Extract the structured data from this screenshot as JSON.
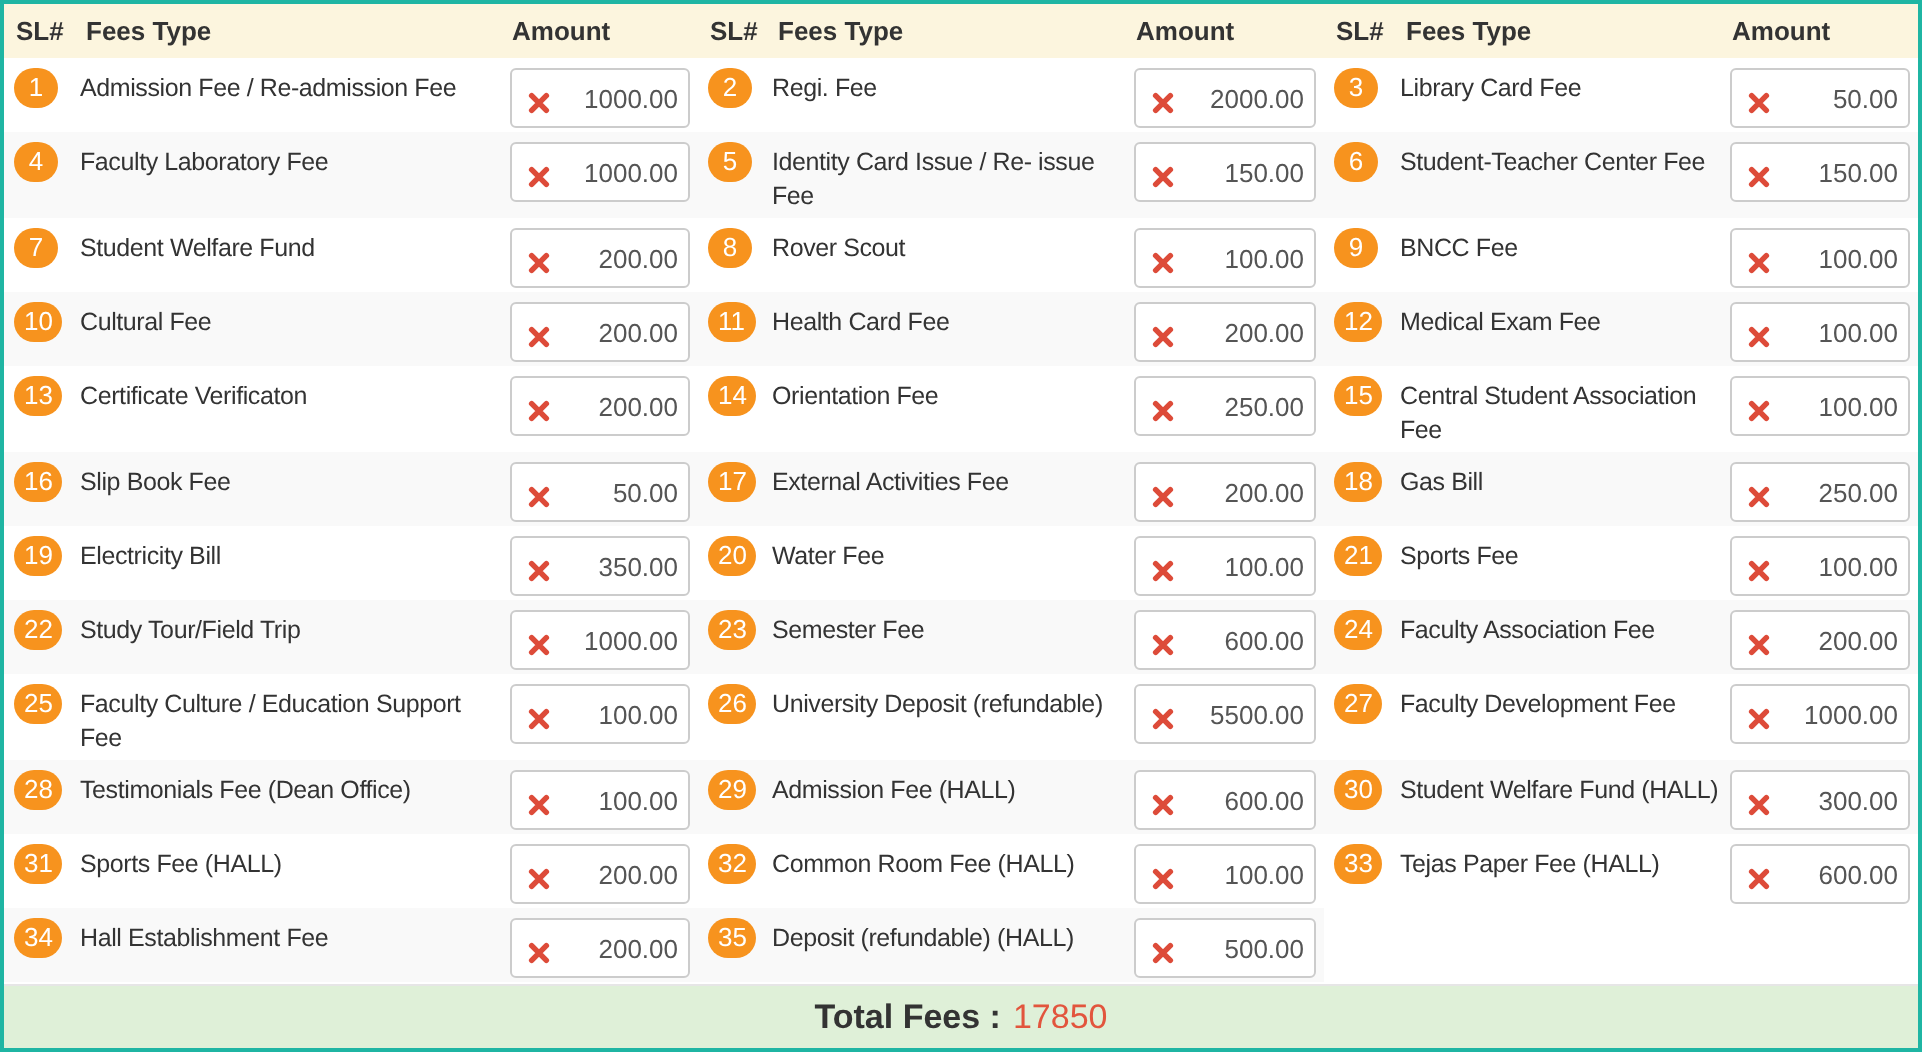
{
  "columns": [
    {
      "sl": "SL#",
      "type": "Fees Type",
      "amount": "Amount"
    },
    {
      "sl": "SL#",
      "type": "Fees Type",
      "amount": "Amount"
    },
    {
      "sl": "SL#",
      "type": "Fees Type",
      "amount": "Amount"
    }
  ],
  "fees": [
    {
      "no": "1",
      "name": "Admission Fee / Re-admission Fee",
      "amount": "1000.00"
    },
    {
      "no": "2",
      "name": "Regi. Fee",
      "amount": "2000.00"
    },
    {
      "no": "3",
      "name": "Library Card Fee",
      "amount": "50.00"
    },
    {
      "no": "4",
      "name": "Faculty Laboratory Fee",
      "amount": "1000.00"
    },
    {
      "no": "5",
      "name": "Identity Card Issue / Re- issue Fee",
      "amount": "150.00"
    },
    {
      "no": "6",
      "name": "Student-Teacher Center Fee",
      "amount": "150.00"
    },
    {
      "no": "7",
      "name": "Student Welfare Fund",
      "amount": "200.00"
    },
    {
      "no": "8",
      "name": "Rover Scout",
      "amount": "100.00"
    },
    {
      "no": "9",
      "name": "BNCC Fee",
      "amount": "100.00"
    },
    {
      "no": "10",
      "name": "Cultural Fee",
      "amount": "200.00"
    },
    {
      "no": "11",
      "name": "Health Card Fee",
      "amount": "200.00"
    },
    {
      "no": "12",
      "name": "Medical Exam Fee",
      "amount": "100.00"
    },
    {
      "no": "13",
      "name": "Certificate Verificaton",
      "amount": "200.00"
    },
    {
      "no": "14",
      "name": "Orientation Fee",
      "amount": "250.00"
    },
    {
      "no": "15",
      "name": "Central Student Association Fee",
      "amount": "100.00"
    },
    {
      "no": "16",
      "name": "Slip Book Fee",
      "amount": "50.00"
    },
    {
      "no": "17",
      "name": "External Activities Fee",
      "amount": "200.00"
    },
    {
      "no": "18",
      "name": "Gas Bill",
      "amount": "250.00"
    },
    {
      "no": "19",
      "name": "Electricity Bill",
      "amount": "350.00"
    },
    {
      "no": "20",
      "name": "Water Fee",
      "amount": "100.00"
    },
    {
      "no": "21",
      "name": "Sports Fee",
      "amount": "100.00"
    },
    {
      "no": "22",
      "name": "Study Tour/Field Trip",
      "amount": "1000.00"
    },
    {
      "no": "23",
      "name": "Semester Fee",
      "amount": "600.00"
    },
    {
      "no": "24",
      "name": "Faculty Association Fee",
      "amount": "200.00"
    },
    {
      "no": "25",
      "name": "Faculty Culture / Education Support Fee",
      "amount": "100.00"
    },
    {
      "no": "26",
      "name": "University Deposit (refundable)",
      "amount": "5500.00"
    },
    {
      "no": "27",
      "name": "Faculty Development Fee",
      "amount": "1000.00"
    },
    {
      "no": "28",
      "name": "Testimonials Fee (Dean Office)",
      "amount": "100.00"
    },
    {
      "no": "29",
      "name": "Admission Fee (HALL)",
      "amount": "600.00"
    },
    {
      "no": "30",
      "name": "Student Welfare Fund (HALL)",
      "amount": "300.00"
    },
    {
      "no": "31",
      "name": "Sports Fee (HALL)",
      "amount": "200.00"
    },
    {
      "no": "32",
      "name": "Common Room Fee (HALL)",
      "amount": "100.00"
    },
    {
      "no": "33",
      "name": "Tejas Paper Fee (HALL)",
      "amount": "600.00"
    },
    {
      "no": "34",
      "name": "Hall Establishment Fee",
      "amount": "200.00"
    },
    {
      "no": "35",
      "name": "Deposit (refundable) (HALL)",
      "amount": "500.00"
    }
  ],
  "total": {
    "label": "Total Fees :",
    "value": "17850"
  }
}
